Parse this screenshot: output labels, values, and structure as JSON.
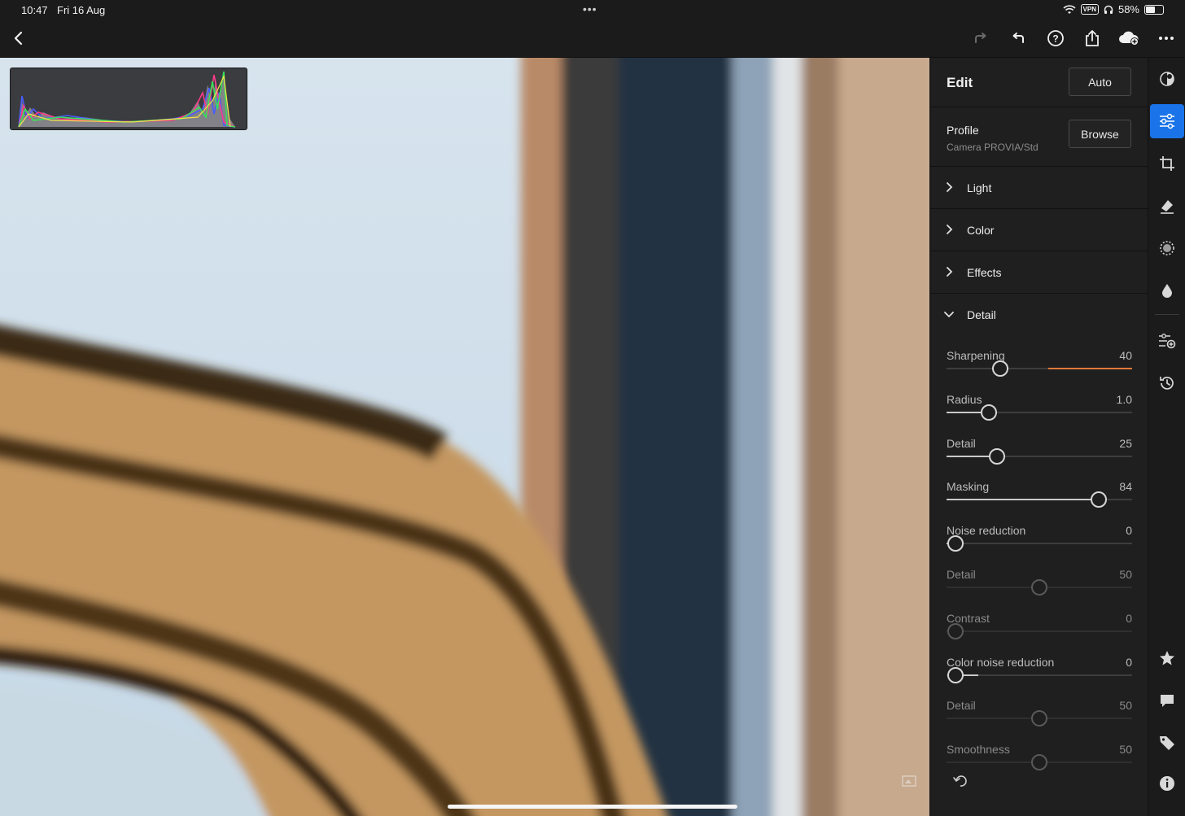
{
  "status_bar": {
    "time": "10:47",
    "date": "Fri 16 Aug",
    "center_dots": "•••",
    "vpn": "VPN",
    "battery": "58%",
    "battery_level": 0.58
  },
  "toolbar": {
    "icons": [
      "back-icon",
      "redo-icon",
      "undo-icon",
      "help-icon",
      "share-icon",
      "cloud-add-icon",
      "more-icon"
    ]
  },
  "panel": {
    "title": "Edit",
    "auto_label": "Auto",
    "profile_label": "Profile",
    "profile_value": "Camera PROVIA/Std",
    "browse_label": "Browse",
    "sections": [
      {
        "label": "Light",
        "expanded": false
      },
      {
        "label": "Color",
        "expanded": false
      },
      {
        "label": "Effects",
        "expanded": false
      },
      {
        "label": "Detail",
        "expanded": true
      }
    ],
    "detail_sliders": [
      {
        "label": "Sharpening",
        "value": "40",
        "position": 0.29,
        "enabled": true
      },
      {
        "label": "Radius",
        "value": "1.0",
        "position": 0.23,
        "enabled": true
      },
      {
        "label": "Detail",
        "value": "25",
        "position": 0.27,
        "enabled": true
      },
      {
        "label": "Masking",
        "value": "84",
        "position": 0.82,
        "enabled": true
      },
      {
        "label": "Noise reduction",
        "value": "0",
        "position": 0.05,
        "enabled": true
      },
      {
        "label": "Detail",
        "value": "50",
        "position": 0.5,
        "enabled": false
      },
      {
        "label": "Contrast",
        "value": "0",
        "position": 0.05,
        "enabled": false
      },
      {
        "label": "Color noise reduction",
        "value": "0",
        "position": 0.05,
        "enabled": true
      },
      {
        "label": "Detail",
        "value": "50",
        "position": 0.5,
        "enabled": false
      },
      {
        "label": "Smoothness",
        "value": "50",
        "position": 0.5,
        "enabled": false
      }
    ]
  },
  "rail": {
    "icons": [
      "presets-icon",
      "edit-sliders-icon",
      "crop-icon",
      "healing-icon",
      "masking-icon",
      "blur-icon",
      "versions-icon",
      "history-icon",
      "star-icon",
      "comment-icon",
      "tag-icon",
      "info-icon"
    ],
    "active": "edit-sliders-icon"
  },
  "colors": {
    "accent": "#1a73e8",
    "panel_bg": "#1f1f1f",
    "sharpening_indicator": "#e0793a"
  }
}
